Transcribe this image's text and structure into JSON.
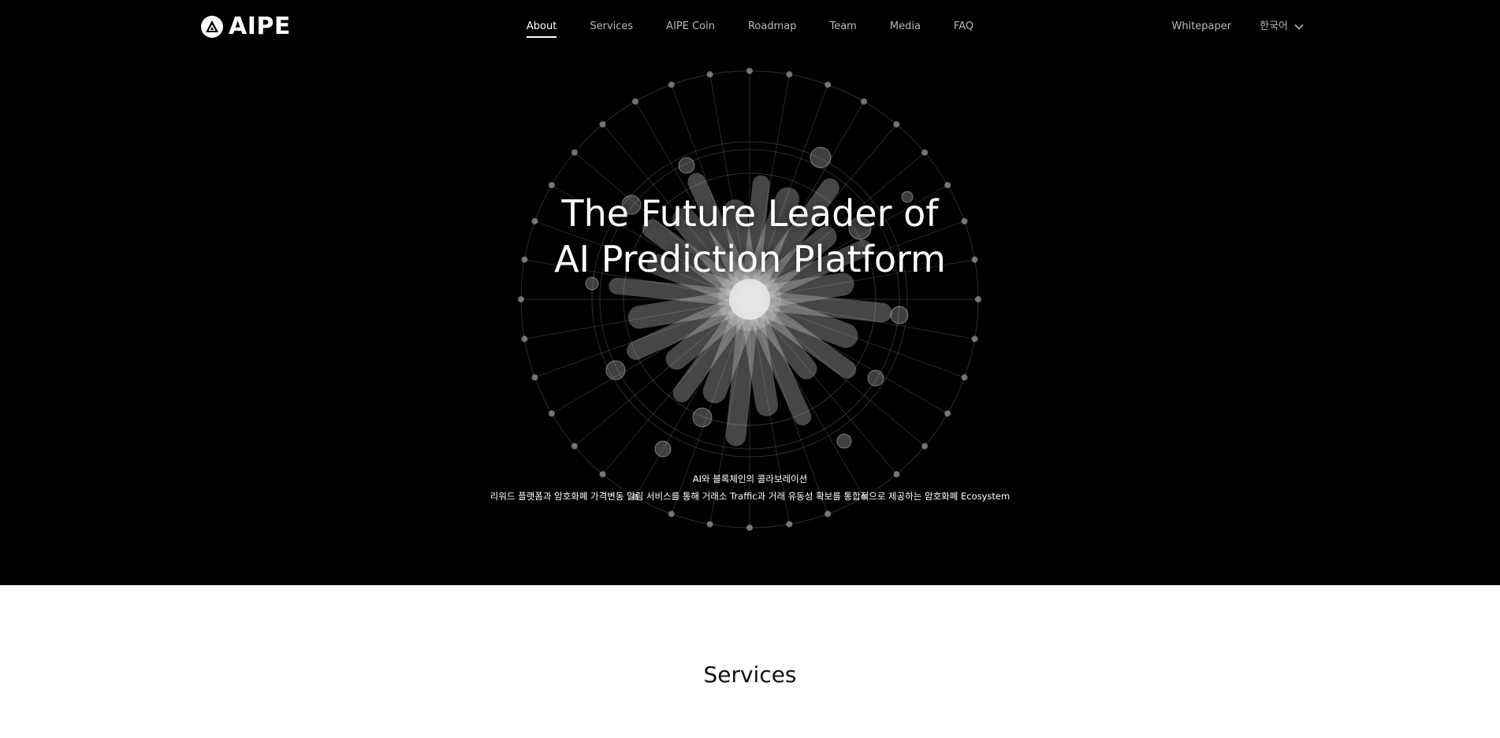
{
  "header": {
    "logo_text": "AIPE",
    "nav": [
      {
        "label": "About",
        "active": true
      },
      {
        "label": "Services",
        "active": false
      },
      {
        "label": "AIPE Coin",
        "active": false
      },
      {
        "label": "Roadmap",
        "active": false
      },
      {
        "label": "Team",
        "active": false
      },
      {
        "label": "Media",
        "active": false
      },
      {
        "label": "FAQ",
        "active": false
      }
    ],
    "whitepaper_label": "Whitepaper",
    "language_label": "한국어"
  },
  "hero": {
    "title_line1": "The Future Leader of",
    "title_line2": "AI Prediction Platform",
    "subtitle_line1": "AI와 블록체인의 콜라보레이션",
    "subtitle_line2": "리워드 플랫폼과 암호화폐 가격변동 알림 서비스를 통해 거래소 Traffic과 거래 유동성 확보를 통합적으로 제공하는 암호화폐 Ecosystem"
  },
  "services": {
    "title": "Services"
  },
  "colors": {
    "hero_background": "#000000",
    "page_background": "#ffffff",
    "nav_text": "#b8b8b8",
    "active_text": "#ffffff"
  },
  "icons": {
    "logo": "aipe-logo-icon",
    "language_dropdown": "chevron-down-icon"
  }
}
